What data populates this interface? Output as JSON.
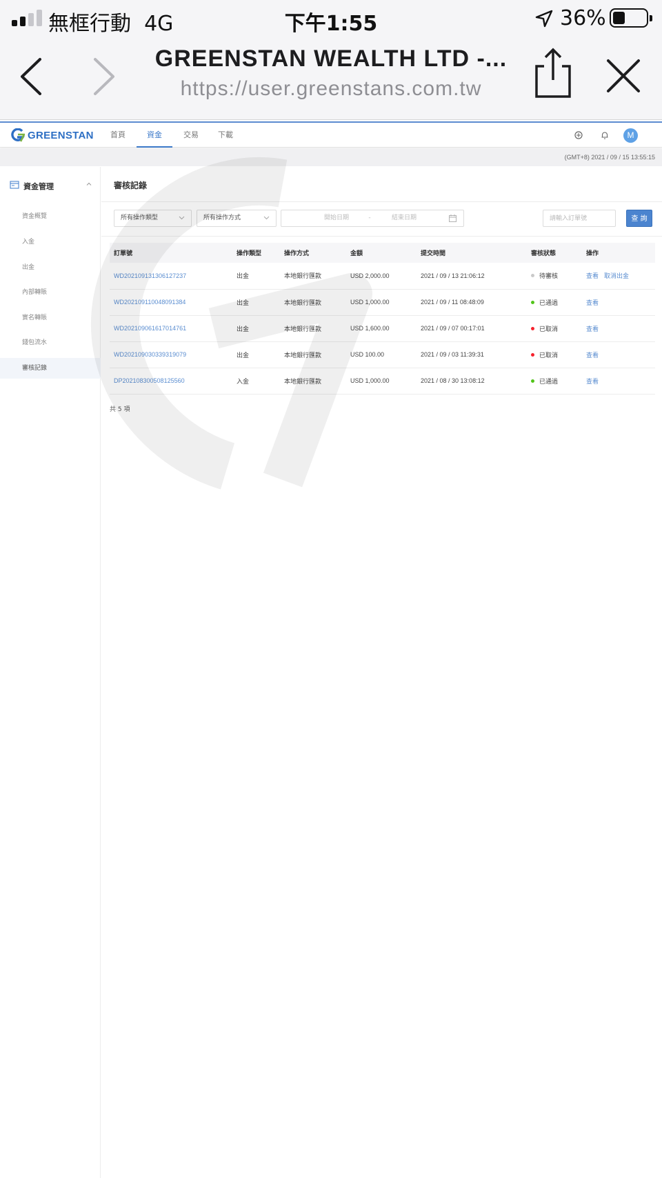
{
  "status_bar": {
    "carrier": "無框行動",
    "network": "4G",
    "time": "下午1:55",
    "battery": "36%",
    "battery_level": 0.36
  },
  "browser": {
    "title": "GREENSTAN WEALTH LTD -...",
    "url": "https://user.greenstans.com.tw"
  },
  "app": {
    "logo_text": "GREENSTAN",
    "brand_color": "#2d6fc4",
    "accent_color": "#4b84cf",
    "nav": [
      {
        "label": "首頁",
        "active": false
      },
      {
        "label": "資金",
        "active": true
      },
      {
        "label": "交易",
        "active": false
      },
      {
        "label": "下載",
        "active": false
      }
    ],
    "avatar_initial": "M",
    "server_time": "(GMT+8) 2021 / 09 / 15 13:55:15"
  },
  "sidebar": {
    "section": "資金管理",
    "items": [
      {
        "label": "資金概覽",
        "active": false
      },
      {
        "label": "入金",
        "active": false
      },
      {
        "label": "出金",
        "active": false
      },
      {
        "label": "內部轉賬",
        "active": false
      },
      {
        "label": "實名轉賬",
        "active": false
      },
      {
        "label": "錢包流水",
        "active": false
      },
      {
        "label": "審核記錄",
        "active": true
      }
    ]
  },
  "main": {
    "title": "審核記錄",
    "filters": {
      "type_select": "所有操作類型",
      "method_select": "所有操作方式",
      "start_date": "開始日期",
      "date_separator": "-",
      "end_date": "結束日期",
      "order_placeholder": "請輸入訂單號",
      "query_label": "查 詢"
    },
    "table": {
      "headers": [
        "訂單號",
        "操作類型",
        "操作方式",
        "金額",
        "提交時間",
        "審核狀態",
        "操作"
      ],
      "rows": [
        {
          "order": "WD202109131306127237",
          "type": "出金",
          "method": "本地銀行匯款",
          "amount": "USD 2,000.00",
          "time": "2021 / 09 / 13 21:06:12",
          "status": "待審核",
          "status_color": "#c9c9c9",
          "actions": [
            "查看",
            "取消出金"
          ]
        },
        {
          "order": "WD202109110048091384",
          "type": "出金",
          "method": "本地銀行匯款",
          "amount": "USD 1,000.00",
          "time": "2021 / 09 / 11 08:48:09",
          "status": "已通過",
          "status_color": "#52c41a",
          "actions": [
            "查看"
          ]
        },
        {
          "order": "WD202109061617014761",
          "type": "出金",
          "method": "本地銀行匯款",
          "amount": "USD 1,600.00",
          "time": "2021 / 09 / 07 00:17:01",
          "status": "已取消",
          "status_color": "#f5222d",
          "actions": [
            "查看"
          ]
        },
        {
          "order": "WD202109030339319079",
          "type": "出金",
          "method": "本地銀行匯款",
          "amount": "USD 100.00",
          "time": "2021 / 09 / 03 11:39:31",
          "status": "已取消",
          "status_color": "#f5222d",
          "actions": [
            "查看"
          ]
        },
        {
          "order": "DP202108300508125560",
          "type": "入金",
          "method": "本地銀行匯款",
          "amount": "USD 1,000.00",
          "time": "2021 / 08 / 30 13:08:12",
          "status": "已通過",
          "status_color": "#52c41a",
          "actions": [
            "查看"
          ]
        }
      ]
    },
    "total": "共 5 項"
  }
}
